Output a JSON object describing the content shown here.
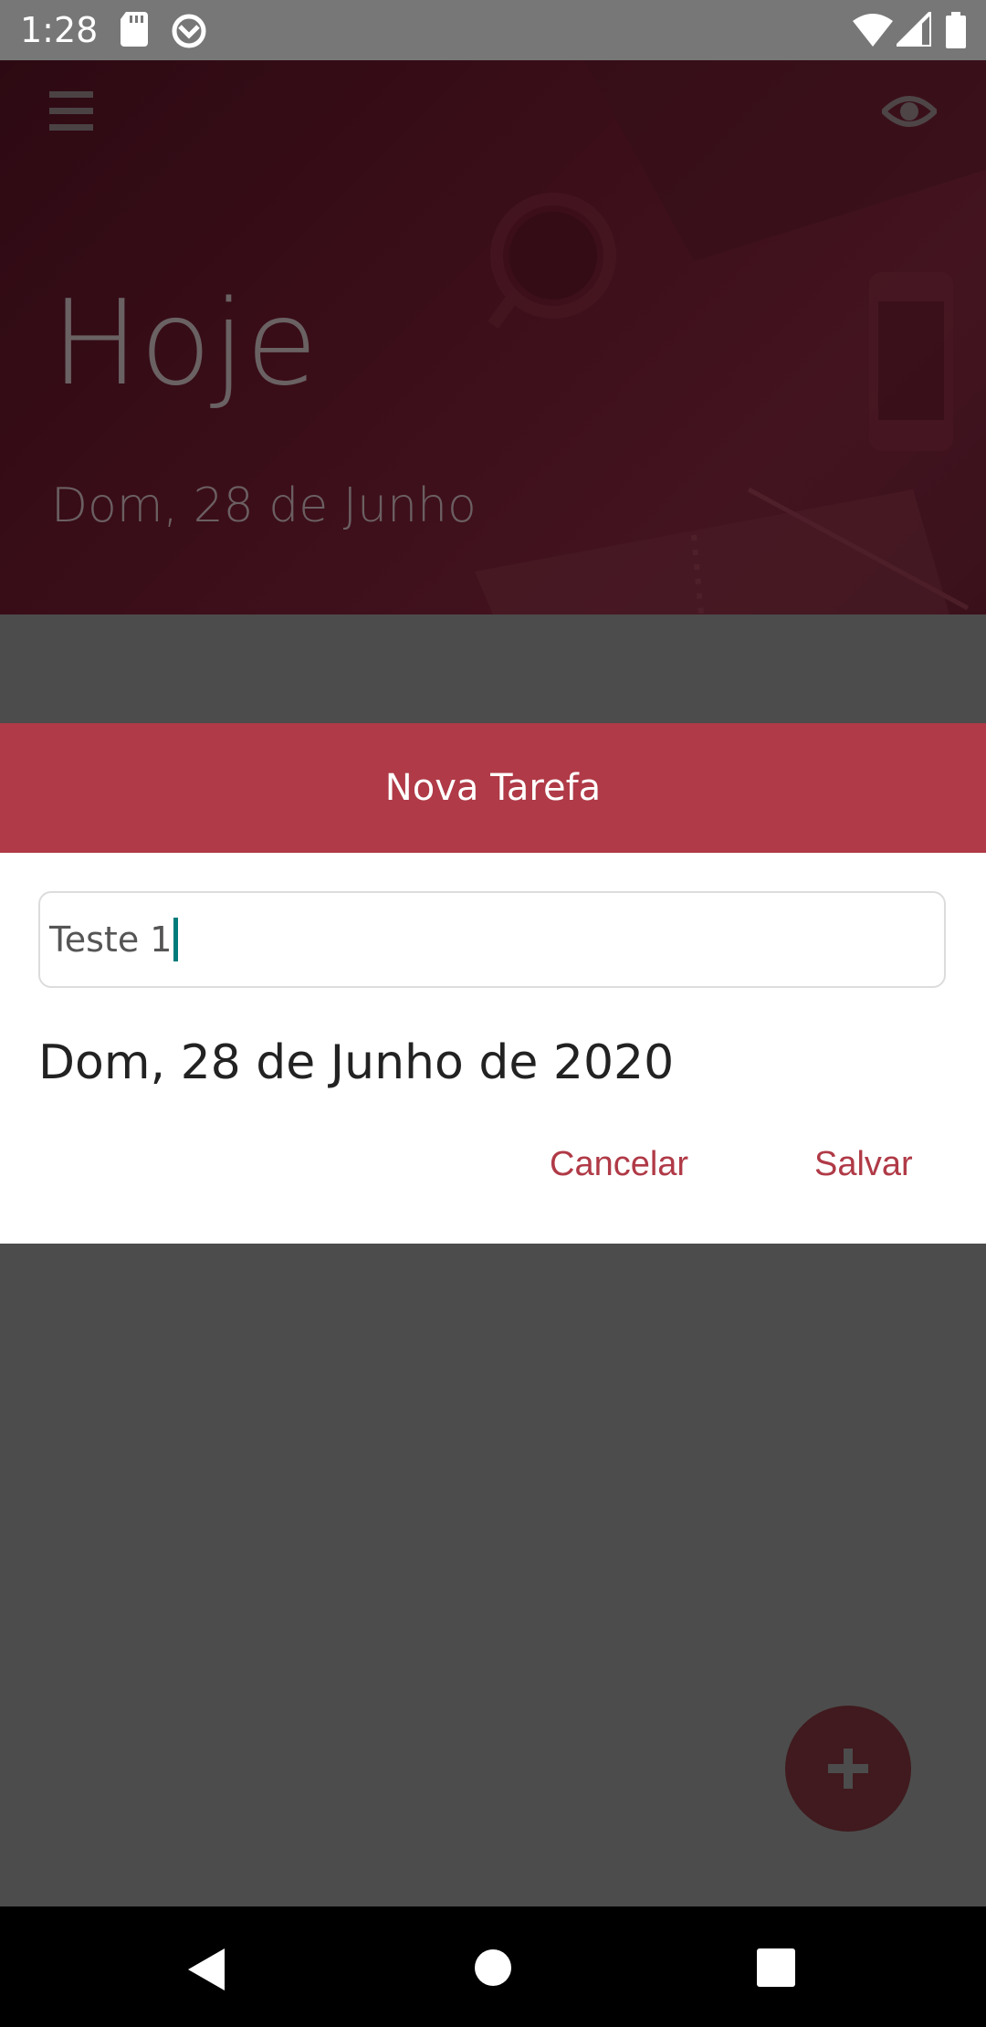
{
  "status_bar": {
    "time": "1:28"
  },
  "header": {
    "title": "Hoje",
    "subtitle": "Dom, 28 de Junho"
  },
  "dialog": {
    "title": "Nova Tarefa",
    "task_input_value": "Teste 1",
    "date": "Dom, 28 de Junho de 2020",
    "cancel_label": "Cancelar",
    "save_label": "Salvar"
  },
  "colors": {
    "accent": "#b03a47",
    "header_bg": "#3b0e19",
    "overlay": "#4c4c4c",
    "caret": "#007c7a"
  },
  "icons": {
    "status": [
      "sd-card-icon",
      "sync-icon",
      "wifi-icon",
      "signal-icon",
      "battery-icon"
    ],
    "header": [
      "menu-icon",
      "eye-icon"
    ],
    "fab": "plus-icon",
    "nav": [
      "back-icon",
      "home-icon",
      "recents-icon"
    ]
  }
}
